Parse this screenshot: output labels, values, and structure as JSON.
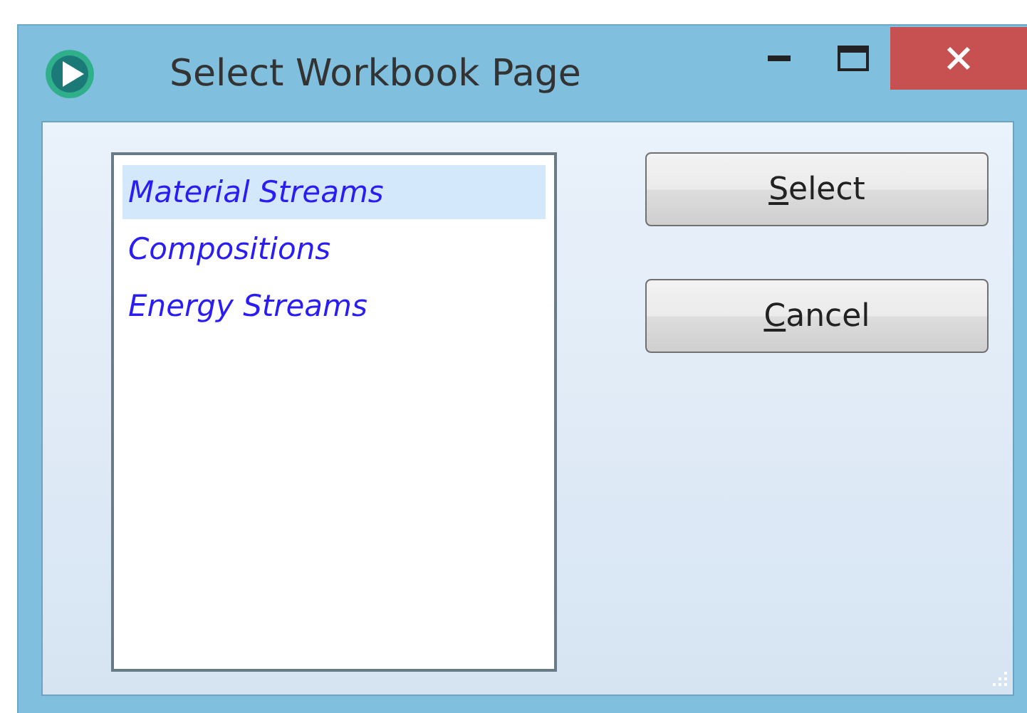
{
  "window": {
    "title": "Select Workbook Page"
  },
  "list": {
    "items": [
      {
        "label": "Material Streams",
        "selected": true
      },
      {
        "label": "Compositions",
        "selected": false
      },
      {
        "label": "Energy Streams",
        "selected": false
      }
    ]
  },
  "buttons": [
    {
      "label": "Select"
    },
    {
      "label": "Cancel"
    }
  ]
}
